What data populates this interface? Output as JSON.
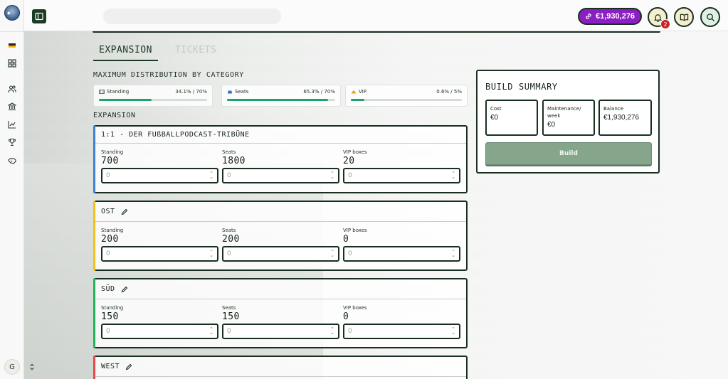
{
  "header": {
    "balance": "€1,930,276",
    "notification_count": "2"
  },
  "sidebar": {
    "items": [
      {
        "icon": "flag-icon"
      },
      {
        "icon": "dashboard-icon"
      },
      {
        "icon": "users-icon"
      },
      {
        "icon": "bank-icon"
      },
      {
        "icon": "chart-icon"
      },
      {
        "icon": "trophy-icon"
      },
      {
        "icon": "handshake-icon"
      }
    ],
    "avatar_initial": "G"
  },
  "tabs": [
    {
      "label": "EXPANSION",
      "active": true
    },
    {
      "label": "TICKETS",
      "active": false
    }
  ],
  "distribution": {
    "title": "MAXIMUM DISTRIBUTION BY CATEGORY",
    "categories": [
      {
        "label": "Standing",
        "value": "34.1% / 70%",
        "fill": 0.487,
        "icon": "standing-icon"
      },
      {
        "label": "Seats",
        "value": "65.3% / 70%",
        "fill": 0.933,
        "icon": "seats-icon"
      },
      {
        "label": "VIP",
        "value": "0.6% / 5%",
        "fill": 0.12,
        "icon": "vip-icon"
      }
    ]
  },
  "expansion": {
    "title": "EXPANSION",
    "field_labels": {
      "standing": "Standing",
      "seats": "Seats",
      "vip": "VIP boxes"
    },
    "input_placeholder": "0",
    "stands": [
      {
        "name": "1:1 - DER FUßBALLPODCAST-TRIBÜNE",
        "accent": "#3b82d6",
        "editable": false,
        "standing": "700",
        "seats": "1800",
        "vip": "20"
      },
      {
        "name": "OST",
        "accent": "#f1c21b",
        "editable": true,
        "standing": "200",
        "seats": "200",
        "vip": "0"
      },
      {
        "name": "SÜD",
        "accent": "#22b35a",
        "editable": true,
        "standing": "150",
        "seats": "150",
        "vip": "0"
      },
      {
        "name": "WEST",
        "accent": "#e5484d",
        "editable": true
      }
    ]
  },
  "summary": {
    "title": "BUILD SUMMARY",
    "cost_label": "Cost",
    "cost_value": "€0",
    "maintenance_label": "Maintenance/ week",
    "maintenance_value": "€0",
    "balance_label": "Balance",
    "balance_value": "€1,930,276",
    "build_label": "Build"
  }
}
